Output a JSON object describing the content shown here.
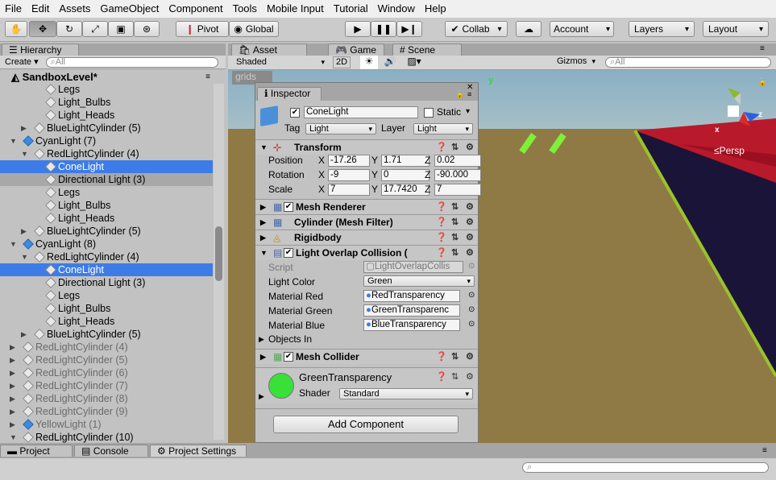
{
  "menu": [
    "File",
    "Edit",
    "Assets",
    "GameObject",
    "Component",
    "Tools",
    "Mobile Input",
    "Tutorial",
    "Window",
    "Help"
  ],
  "toolbar": {
    "pivot": "Pivot",
    "global": "Global",
    "collab": "Collab",
    "account": "Account",
    "layers": "Layers",
    "layout": "Layout"
  },
  "hierarchy": {
    "tab": "Hierarchy",
    "create": "Create",
    "search": "All",
    "scene": "SandboxLevel*",
    "rows": [
      {
        "label": "Legs",
        "indent": 4,
        "arrow": "",
        "sel": false,
        "dim": false,
        "blue": false
      },
      {
        "label": "Light_Bulbs",
        "indent": 4,
        "arrow": "",
        "sel": false,
        "dim": false,
        "blue": false
      },
      {
        "label": "Light_Heads",
        "indent": 4,
        "arrow": "",
        "sel": false,
        "dim": false,
        "blue": false
      },
      {
        "label": "BlueLightCylinder (5)",
        "indent": 3,
        "arrow": "▶",
        "sel": false,
        "dim": false,
        "blue": false
      },
      {
        "label": "CyanLight (7)",
        "indent": 2,
        "arrow": "▼",
        "sel": false,
        "dim": false,
        "blue": true
      },
      {
        "label": "RedLightCylinder (4)",
        "indent": 3,
        "arrow": "▼",
        "sel": false,
        "dim": false,
        "blue": false
      },
      {
        "label": "ConeLight",
        "indent": 4,
        "arrow": "",
        "sel": true,
        "dim": false,
        "blue": false
      },
      {
        "label": "Directional Light (3)",
        "indent": 4,
        "arrow": "",
        "sel": false,
        "dim": false,
        "blue": false,
        "grey": true
      },
      {
        "label": "Legs",
        "indent": 4,
        "arrow": "",
        "sel": false,
        "dim": false,
        "blue": false
      },
      {
        "label": "Light_Bulbs",
        "indent": 4,
        "arrow": "",
        "sel": false,
        "dim": false,
        "blue": false
      },
      {
        "label": "Light_Heads",
        "indent": 4,
        "arrow": "",
        "sel": false,
        "dim": false,
        "blue": false
      },
      {
        "label": "BlueLightCylinder (5)",
        "indent": 3,
        "arrow": "▶",
        "sel": false,
        "dim": false,
        "blue": false
      },
      {
        "label": "CyanLight (8)",
        "indent": 2,
        "arrow": "▼",
        "sel": false,
        "dim": false,
        "blue": true
      },
      {
        "label": "RedLightCylinder (4)",
        "indent": 3,
        "arrow": "▼",
        "sel": false,
        "dim": false,
        "blue": false
      },
      {
        "label": "ConeLight",
        "indent": 4,
        "arrow": "",
        "sel": true,
        "dim": false,
        "blue": false
      },
      {
        "label": "Directional Light (3)",
        "indent": 4,
        "arrow": "",
        "sel": false,
        "dim": false,
        "blue": false
      },
      {
        "label": "Legs",
        "indent": 4,
        "arrow": "",
        "sel": false,
        "dim": false,
        "blue": false
      },
      {
        "label": "Light_Bulbs",
        "indent": 4,
        "arrow": "",
        "sel": false,
        "dim": false,
        "blue": false
      },
      {
        "label": "Light_Heads",
        "indent": 4,
        "arrow": "",
        "sel": false,
        "dim": false,
        "blue": false
      },
      {
        "label": "BlueLightCylinder (5)",
        "indent": 3,
        "arrow": "▶",
        "sel": false,
        "dim": false,
        "blue": false
      },
      {
        "label": "RedLightCylinder (4)",
        "indent": 2,
        "arrow": "▶",
        "sel": false,
        "dim": true,
        "blue": false
      },
      {
        "label": "RedLightCylinder (5)",
        "indent": 2,
        "arrow": "▶",
        "sel": false,
        "dim": true,
        "blue": false
      },
      {
        "label": "RedLightCylinder (6)",
        "indent": 2,
        "arrow": "▶",
        "sel": false,
        "dim": true,
        "blue": false
      },
      {
        "label": "RedLightCylinder (7)",
        "indent": 2,
        "arrow": "▶",
        "sel": false,
        "dim": true,
        "blue": false
      },
      {
        "label": "RedLightCylinder (8)",
        "indent": 2,
        "arrow": "▶",
        "sel": false,
        "dim": true,
        "blue": false
      },
      {
        "label": "RedLightCylinder (9)",
        "indent": 2,
        "arrow": "▶",
        "sel": false,
        "dim": true,
        "blue": false
      },
      {
        "label": "YellowLight (1)",
        "indent": 2,
        "arrow": "▶",
        "sel": false,
        "dim": true,
        "blue": true
      },
      {
        "label": "RedLightCylinder (10)",
        "indent": 2,
        "arrow": "▼",
        "sel": false,
        "dim": false,
        "blue": false
      }
    ]
  },
  "scene": {
    "tab_store": "Asset Store",
    "tab_game": "Game",
    "tab_scene": "Scene",
    "shaded": "Shaded",
    "twod": "2D",
    "gizmos": "Gizmos",
    "search": "All",
    "persp": "Persp",
    "grids": "grids"
  },
  "inspector": {
    "tab": "Inspector",
    "name": "ConeLight",
    "static": "Static",
    "tag_label": "Tag",
    "tag": "Light",
    "layer_label": "Layer",
    "layer": "Light",
    "transform": "Transform",
    "position_label": "Position",
    "rotation_label": "Rotation",
    "scale_label": "Scale",
    "pos": {
      "x": "-17.26",
      "y": "1.71",
      "z": "0.02"
    },
    "rot": {
      "x": "-9",
      "y": "0",
      "z": "-90.000"
    },
    "scl": {
      "x": "7",
      "y": "17.7420",
      "z": "7"
    },
    "components": [
      "Mesh Renderer",
      "Cylinder (Mesh Filter)",
      "Rigidbody",
      "Light Overlap Collision ("
    ],
    "script_label": "Script",
    "script": "LightOverlapCollis",
    "lightcolor_label": "Light Color",
    "lightcolor": "Green",
    "matred_label": "Material Red",
    "matred": "RedTransparency",
    "matgreen_label": "Material Green",
    "matgreen": "GreenTransparenc",
    "matblue_label": "Material Blue",
    "matblue": "BlueTransparency",
    "objects_in": "Objects In",
    "mesh_collider": "Mesh Collider",
    "material": "GreenTransparency",
    "shader_label": "Shader",
    "shader": "Standard",
    "add": "Add Component"
  },
  "bottom": {
    "project": "Project",
    "console": "Console",
    "settings": "Project Settings"
  },
  "colors": {
    "selection": "#3d7ce7",
    "green": "#39e03a"
  }
}
